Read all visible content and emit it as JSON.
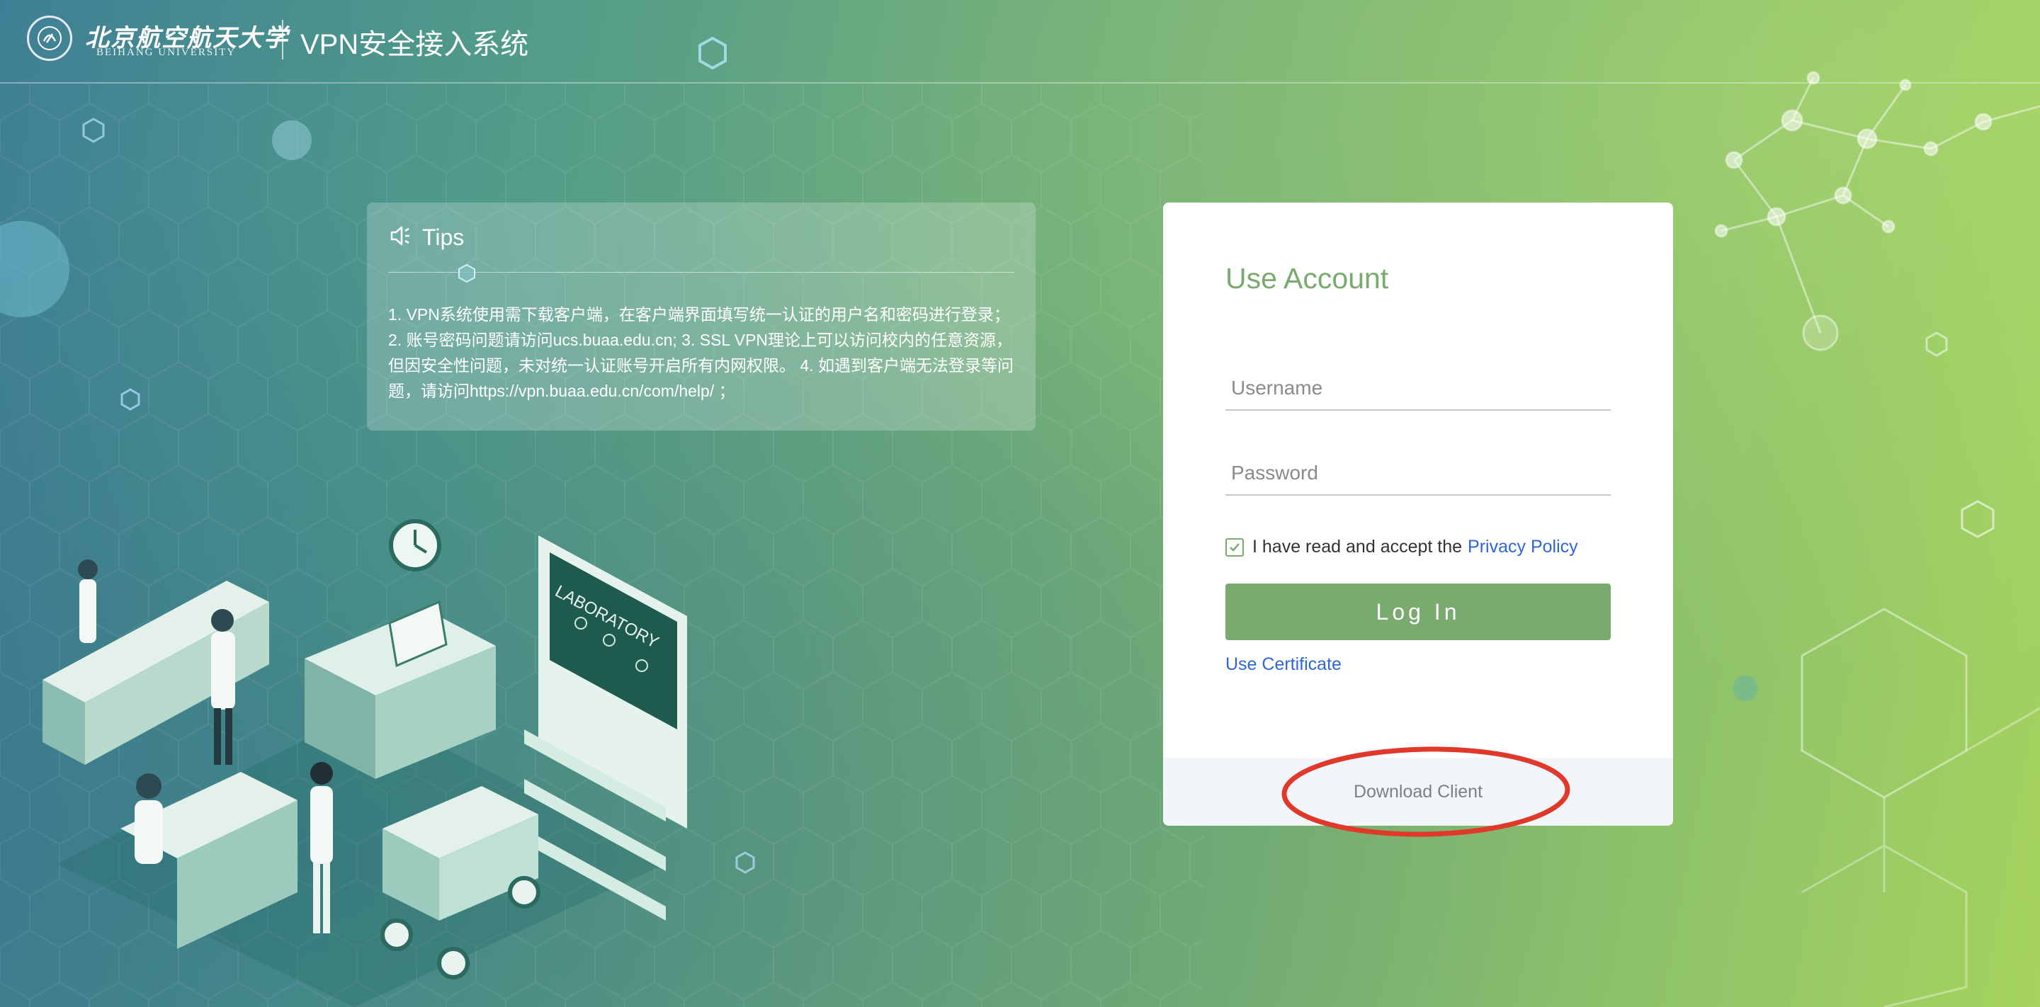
{
  "header": {
    "logo_cn": "北京航空航天大学",
    "logo_en": "BEIHANG UNIVERSITY",
    "system_title": "VPN安全接入系统"
  },
  "tips": {
    "icon": "speaker-icon",
    "title": "Tips",
    "text": "1. VPN系统使用需下载客户端，在客户端界面填写统一认证的用户名和密码进行登录； 2. 账号密码问题请访问ucs.buaa.edu.cn; 3. SSL VPN理论上可以访问校内的任意资源，但因安全性问题，未对统一认证账号开启所有内网权限。 4. 如遇到客户端无法登录等问题，请访问https://vpn.buaa.edu.cn/com/help/ ；"
  },
  "illustration": {
    "lab_board": "LABORATORY"
  },
  "login": {
    "title": "Use Account",
    "username_placeholder": "Username",
    "password_placeholder": "Password",
    "agree_checked": true,
    "agree_text": "I have read and accept the",
    "privacy_link": "Privacy Policy",
    "login_button": "Log In",
    "certificate_link": "Use Certificate",
    "download_link": "Download Client"
  },
  "colors": {
    "accent_green": "#7aab6e",
    "link_blue": "#2f67d2",
    "annotation_red": "#e0392b"
  }
}
